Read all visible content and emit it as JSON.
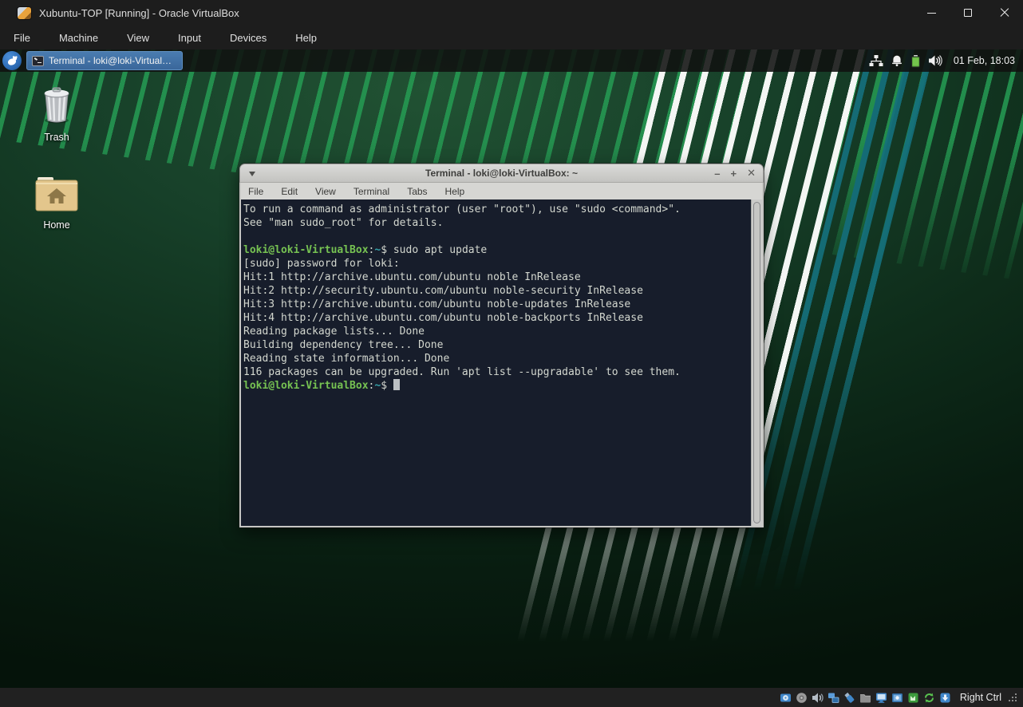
{
  "vbox": {
    "title": "Xubuntu-TOP [Running] - Oracle VirtualBox",
    "menu": [
      "File",
      "Machine",
      "View",
      "Input",
      "Devices",
      "Help"
    ],
    "window_controls": [
      "minimize",
      "maximize",
      "close"
    ],
    "status_icons": [
      "hard-disks",
      "optical-drives",
      "audio",
      "network",
      "usb",
      "shared-folders",
      "display",
      "recording",
      "guest-additions",
      "features",
      "mouse-integration"
    ],
    "host_key": "Right Ctrl"
  },
  "panel": {
    "whisker_icon": "whisker-menu-icon",
    "task_button_label": "Terminal - loki@loki-VirtualB…",
    "tray_icons": [
      "network-icon",
      "notifications-bell-icon",
      "battery-icon",
      "volume-icon"
    ],
    "clock": "01 Feb, 18:03"
  },
  "desktop": {
    "icons": [
      {
        "label": "Trash"
      },
      {
        "label": "Home"
      }
    ]
  },
  "terminal": {
    "title": "Terminal - loki@loki-VirtualBox: ~",
    "menu": [
      "File",
      "Edit",
      "View",
      "Terminal",
      "Tabs",
      "Help"
    ],
    "controls": [
      "–",
      "+",
      "✕"
    ],
    "colors": {
      "background": "#171d2b",
      "foreground": "#d3d7cf",
      "prompt_user": "#76c252",
      "prompt_path": "#35a3aa"
    },
    "lines": [
      {
        "segments": [
          {
            "t": "To run a command as administrator (user \"root\"), use \"sudo <command>\".",
            "c": "fg"
          }
        ]
      },
      {
        "segments": [
          {
            "t": "See \"man sudo_root\" for details.",
            "c": "fg"
          }
        ]
      },
      {
        "segments": []
      },
      {
        "segments": [
          {
            "t": "loki@loki-VirtualBox",
            "c": "user"
          },
          {
            "t": ":",
            "c": "fg"
          },
          {
            "t": "~",
            "c": "path"
          },
          {
            "t": "$ ",
            "c": "fg"
          },
          {
            "t": "sudo apt update",
            "c": "fg"
          }
        ]
      },
      {
        "segments": [
          {
            "t": "[sudo] password for loki:",
            "c": "fg"
          }
        ]
      },
      {
        "segments": [
          {
            "t": "Hit:1 http://archive.ubuntu.com/ubuntu noble InRelease",
            "c": "fg"
          }
        ]
      },
      {
        "segments": [
          {
            "t": "Hit:2 http://security.ubuntu.com/ubuntu noble-security InRelease",
            "c": "fg"
          }
        ]
      },
      {
        "segments": [
          {
            "t": "Hit:3 http://archive.ubuntu.com/ubuntu noble-updates InRelease",
            "c": "fg"
          }
        ]
      },
      {
        "segments": [
          {
            "t": "Hit:4 http://archive.ubuntu.com/ubuntu noble-backports InRelease",
            "c": "fg"
          }
        ]
      },
      {
        "segments": [
          {
            "t": "Reading package lists... Done",
            "c": "fg"
          }
        ]
      },
      {
        "segments": [
          {
            "t": "Building dependency tree... Done",
            "c": "fg"
          }
        ]
      },
      {
        "segments": [
          {
            "t": "Reading state information... Done",
            "c": "fg"
          }
        ]
      },
      {
        "segments": [
          {
            "t": "116 packages can be upgraded. Run 'apt list --upgradable' to see them.",
            "c": "fg"
          }
        ]
      },
      {
        "segments": [
          {
            "t": "loki@loki-VirtualBox",
            "c": "user"
          },
          {
            "t": ":",
            "c": "fg"
          },
          {
            "t": "~",
            "c": "path"
          },
          {
            "t": "$ ",
            "c": "fg"
          }
        ],
        "cursor": true
      }
    ]
  }
}
